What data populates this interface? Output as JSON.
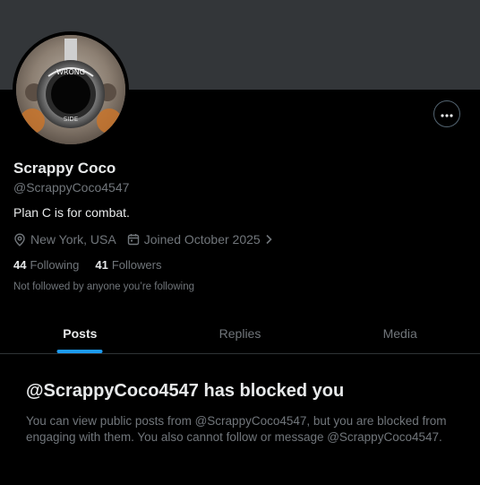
{
  "profile": {
    "name": "Scrappy Coco",
    "handle": "@ScrappyCoco4547",
    "bio": "Plan C is for combat.",
    "location": "New York, USA",
    "joined": "Joined October 2025",
    "avatar_text": "WRONG SIDE",
    "following_count": "44",
    "following_label": "Following",
    "followers_count": "41",
    "followers_label": "Followers",
    "not_followed": "Not followed by anyone you’re following"
  },
  "icons": {
    "more": "more-horizontal-icon",
    "location": "location-pin-icon",
    "calendar": "calendar-icon",
    "chevron": "chevron-right-icon"
  },
  "tabs": [
    {
      "label": "Posts",
      "active": true
    },
    {
      "label": "Replies",
      "active": false
    },
    {
      "label": "Media",
      "active": false
    }
  ],
  "blocked": {
    "title": "@ScrappyCoco4547 has blocked you",
    "body": "You can view public posts from @ScrappyCoco4547, but you are blocked from engaging with them. You also cannot follow or message @ScrappyCoco4547."
  },
  "colors": {
    "background": "#000000",
    "banner": "#333639",
    "accent": "#1d9bf0",
    "text_primary": "#e7e9ea",
    "text_secondary": "#71767b",
    "divider": "#2f3336"
  }
}
